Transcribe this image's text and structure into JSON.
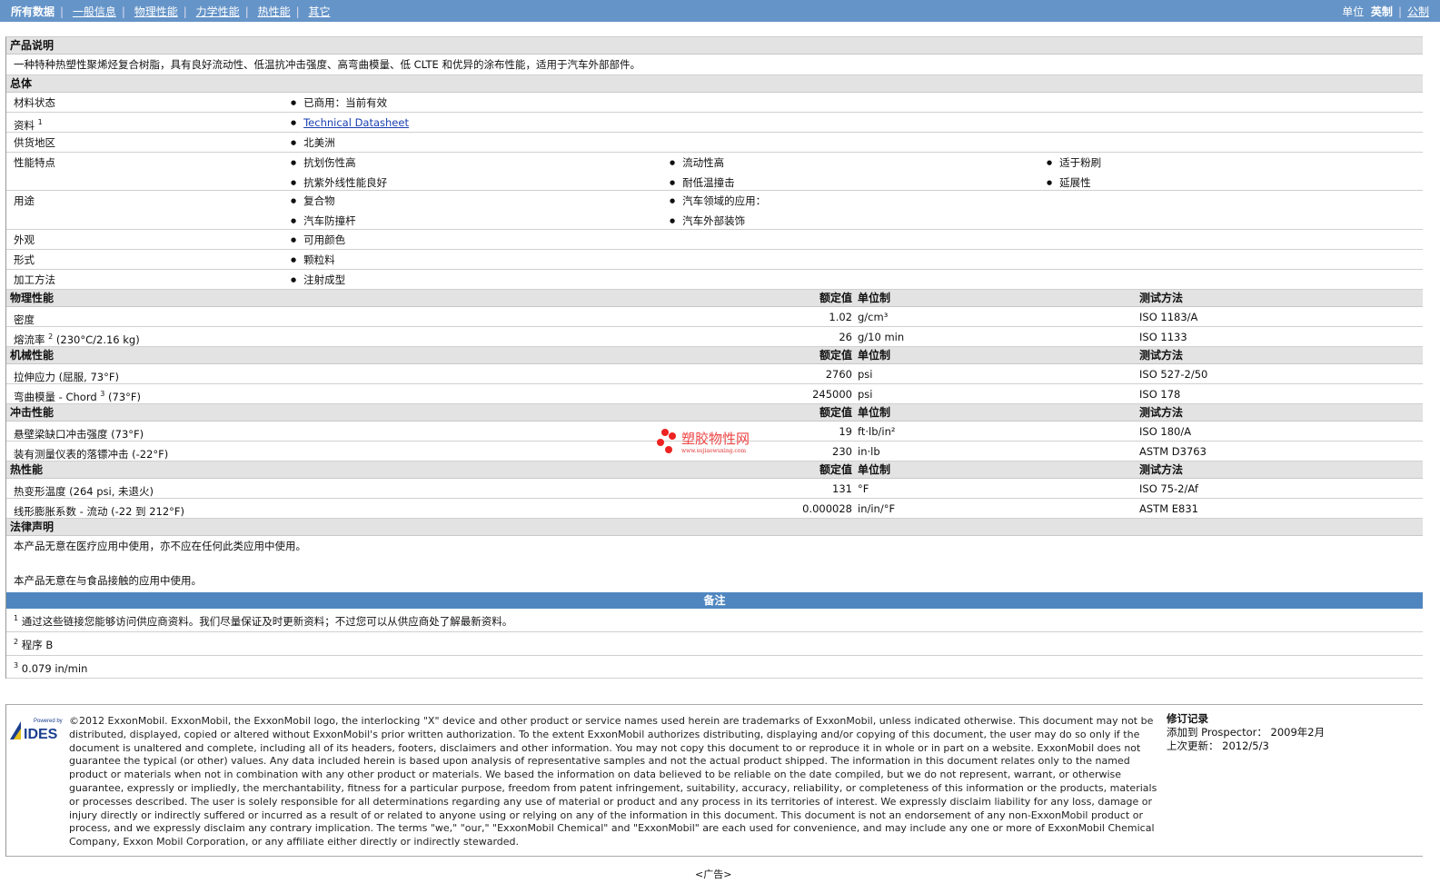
{
  "nav": {
    "items": [
      "所有数据",
      "一般信息",
      "物理性能",
      "力学性能",
      "热性能",
      "其它"
    ],
    "units_label": "单位",
    "unit_active": "英制",
    "unit_other": "公制"
  },
  "desc": {
    "title": "产品说明",
    "text": "一种特种热塑性聚烯烃复合树脂，具有良好流动性、低温抗冲击强度、高弯曲模量、低 CLTE 和优异的涂布性能，适用于汽车外部部件。"
  },
  "general": {
    "title": "总体",
    "status_label": "材料状态",
    "status": "已商用：当前有效",
    "docs_label": "资料",
    "docs_sup": "1",
    "docs_link": "Technical Datasheet",
    "region_label": "供货地区",
    "region": "北美洲",
    "features_label": "性能特点",
    "features": [
      "抗划伤性高",
      "流动性高",
      "适于粉刷",
      "抗紫外线性能良好",
      "耐低温撞击",
      "延展性"
    ],
    "uses_label": "用途",
    "uses": [
      "复合物",
      "汽车领域的应用：",
      "汽车防撞杆",
      "汽车外部装饰"
    ],
    "appearance_label": "外观",
    "appearance": "可用颜色",
    "form_label": "形式",
    "form": "颗粒料",
    "process_label": "加工方法",
    "process": "注射成型"
  },
  "headers": {
    "value": "额定值",
    "unit": "单位制",
    "test": "测试方法"
  },
  "physical": {
    "title": "物理性能",
    "rows": [
      {
        "name": "密度",
        "sup": "",
        "cond": "",
        "value": "1.02",
        "unit": "g/cm³",
        "test": "ISO 1183/A"
      },
      {
        "name": "熔流率",
        "sup": "2",
        "cond": "(230°C/2.16 kg)",
        "value": "26",
        "unit": "g/10 min",
        "test": "ISO 1133"
      }
    ]
  },
  "mechanical": {
    "title": "机械性能",
    "rows": [
      {
        "name": "拉伸应力",
        "sup": "",
        "cond": "(屈服, 73°F)",
        "value": "2760",
        "unit": "psi",
        "test": "ISO 527-2/50"
      },
      {
        "name": "弯曲模量 - Chord",
        "sup": "3",
        "cond": "(73°F)",
        "value": "245000",
        "unit": "psi",
        "test": "ISO 178"
      }
    ]
  },
  "impact": {
    "title": "冲击性能",
    "rows": [
      {
        "name": "悬壁梁缺口冲击强度",
        "sup": "",
        "cond": "(73°F)",
        "value": "19",
        "unit": "ft·lb/in²",
        "test": "ISO 180/A"
      },
      {
        "name": "装有测量仪表的落镖冲击",
        "sup": "",
        "cond": "(-22°F)",
        "value": "230",
        "unit": "in·lb",
        "test": "ASTM D3763"
      }
    ]
  },
  "thermal": {
    "title": "热性能",
    "rows": [
      {
        "name": "热变形温度",
        "sup": "",
        "cond": "(264 psi, 未退火)",
        "value": "131",
        "unit": "°F",
        "test": "ISO 75-2/Af"
      },
      {
        "name": "线形膨胀系数 - 流动",
        "sup": "",
        "cond": "(-22 到 212°F)",
        "value": "0.000028",
        "unit": "in/in/°F",
        "test": "ASTM E831"
      }
    ]
  },
  "legal": {
    "title": "法律声明",
    "lines": [
      "本产品无意在医疗应用中使用，亦不应在任何此类应用中使用。",
      "本产品无意在与食品接触的应用中使用。"
    ]
  },
  "notes": {
    "title": "备注",
    "items": [
      {
        "n": "1",
        "text": "通过这些链接您能够访问供应商资料。我们尽量保证及时更新资料；不过您可以从供应商处了解最新资料。"
      },
      {
        "n": "2",
        "text": "程序 B"
      },
      {
        "n": "3",
        "text": "0.079 in/min"
      }
    ]
  },
  "footer": {
    "logo_text": "Powered by IDES",
    "legal": "©2012 ExxonMobil. ExxonMobil, the ExxonMobil logo, the interlocking \"X\" device and other product or service names used herein are trademarks of ExxonMobil, unless indicated otherwise. This document may not be distributed, displayed, copied or altered without ExxonMobil's prior written authorization. To the extent ExxonMobil authorizes distributing, displaying and/or copying of this document, the user may do so only if the document is unaltered and complete, including all of its headers, footers, disclaimers and other information. You may not copy this document to or reproduce it in whole or in part on a website. ExxonMobil does not guarantee the typical (or other) values. Any data included herein is based upon analysis of representative samples and not the actual product shipped. The information in this document relates only to the named product or materials when not in combination with any other product or materials. We based the information on data believed to be reliable on the date compiled, but we do not represent, warrant, or otherwise guarantee, expressly or impliedly, the merchantability, fitness for a particular purpose, freedom from patent infringement, suitability, accuracy, reliability, or completeness of this information or the products, materials or processes described. The user is solely responsible for all determinations regarding any use of material or product and any process in its territories of interest. We expressly disclaim liability for any loss, damage or injury directly or indirectly suffered or incurred as a result of or related to anyone using or relying on any of the information in this document. This document is not an endorsement of any non-ExxonMobil product or process, and we expressly disclaim any contrary implication. The terms \"we,\" \"our,\" \"ExxonMobil Chemical\" and \"ExxonMobil\" are each used for convenience, and may include any one or more of ExxonMobil Chemical Company, Exxon Mobil Corporation, or any affiliate either directly or indirectly stewarded.",
    "rev_title": "修订记录",
    "rev_added": "添加到 Prospector： 2009年2月",
    "rev_updated": "上次更新： 2012/5/3"
  },
  "ad": "<广告>",
  "watermark": {
    "name": "塑胶物性网",
    "url": "www.sujiaowuxing.com"
  }
}
